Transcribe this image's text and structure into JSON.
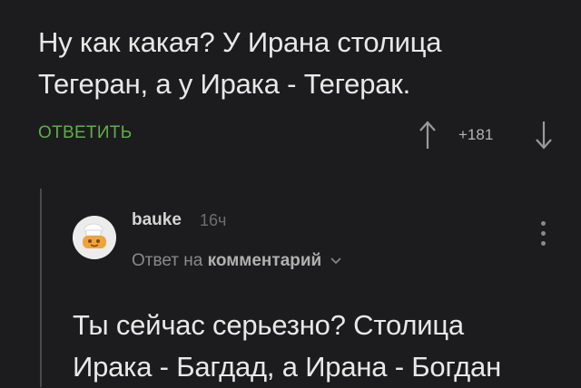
{
  "parent_comment": {
    "text": "Ну как какая? У Ирана столица\nТегеран, а у Ирака - Тегерак.",
    "reply_label": "ОТВЕТИТЬ",
    "rating": "+181"
  },
  "reply_comment": {
    "author": "bauke",
    "time": "16ч",
    "reply_prefix": "Ответ на",
    "reply_target": "комментарий",
    "text": "Ты сейчас серьезно? Столица\nИрака - Багдад, а Ирана - Богдан"
  },
  "icons": {
    "vote_up": "arrow-up-icon",
    "vote_down": "arrow-down-icon",
    "more": "more-vertical-icon",
    "dropdown": "chevron-down-icon"
  },
  "colors": {
    "background": "#1c1c1e",
    "accent_green": "#5fae4a",
    "text": "#e8e8e8",
    "muted": "#8a8a8a"
  }
}
